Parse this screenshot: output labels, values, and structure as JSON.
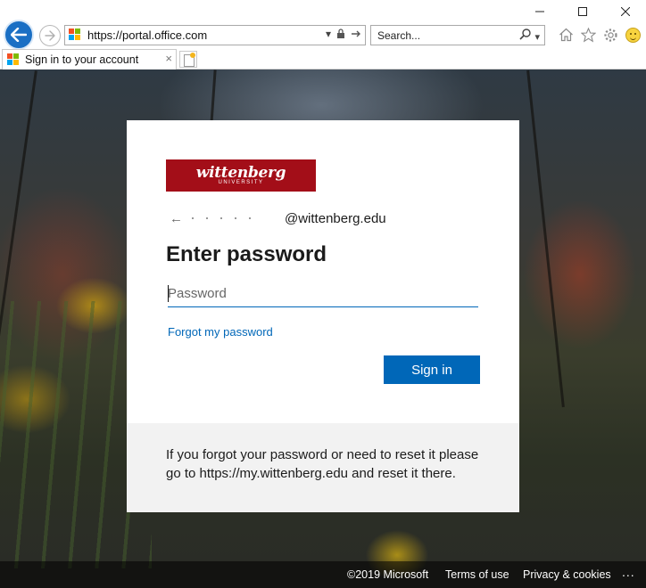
{
  "window": {
    "min_icon": "minimize-icon",
    "max_icon": "maximize-icon",
    "close_icon": "close-icon"
  },
  "navbar": {
    "url": "https://portal.office.com",
    "search_placeholder": "Search...",
    "icons": [
      "back-icon",
      "forward-icon",
      "lock-icon",
      "refresh-icon",
      "search-icon",
      "home-icon",
      "favorites-star-icon",
      "settings-gear-icon",
      "feedback-smiley-icon"
    ]
  },
  "tab": {
    "title": "Sign in to your account",
    "close": "×"
  },
  "card": {
    "logo_text": "wittenberg",
    "logo_sub": "UNIVERSITY",
    "email_suffix": "@wittenberg.edu",
    "heading": "Enter password",
    "password_placeholder": "Password",
    "forgot_link": "Forgot my password",
    "signin_button": "Sign in",
    "help_text": "If you forgot your password or need to reset it please go to https://my.wittenberg.edu and reset it there."
  },
  "footer": {
    "copyright": "©2019 Microsoft",
    "terms": "Terms of use",
    "privacy": "Privacy & cookies",
    "more": "..."
  },
  "colors": {
    "accent": "#0067b8",
    "brand_red": "#a30e18",
    "footer_panel": "#f2f2f2"
  }
}
